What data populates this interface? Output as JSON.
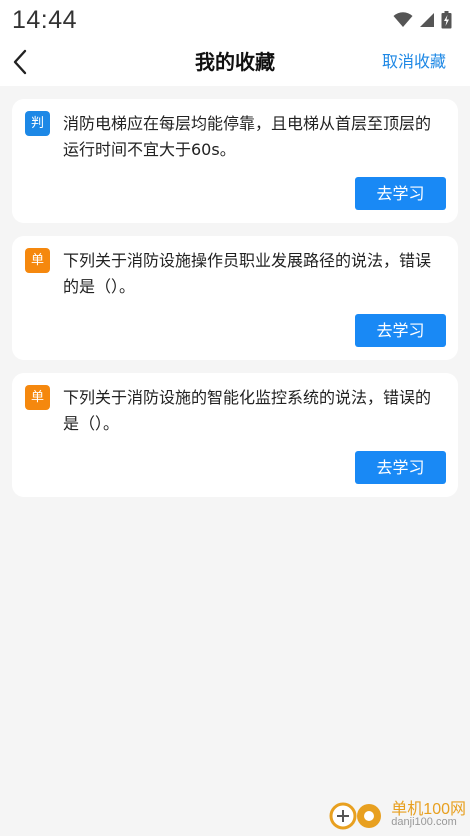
{
  "status_bar": {
    "time": "14:44"
  },
  "header": {
    "title": "我的收藏",
    "action_label": "取消收藏"
  },
  "favorites": [
    {
      "tag": "判",
      "tag_color": "#1d88e6",
      "question": "消防电梯应在每层均能停靠，且电梯从首层至顶层的运行时间不宜大于60s。",
      "button_label": "去学习"
    },
    {
      "tag": "单",
      "tag_color": "#f5880e",
      "question": "下列关于消防设施操作员职业发展路径的说法，错误的是（）。",
      "button_label": "去学习"
    },
    {
      "tag": "单",
      "tag_color": "#f5880e",
      "question": "下列关于消防设施的智能化监控系统的说法，错误的是（）。",
      "button_label": "去学习"
    }
  ],
  "watermark": {
    "brand": "单机100网",
    "domain": "danji100.com"
  }
}
